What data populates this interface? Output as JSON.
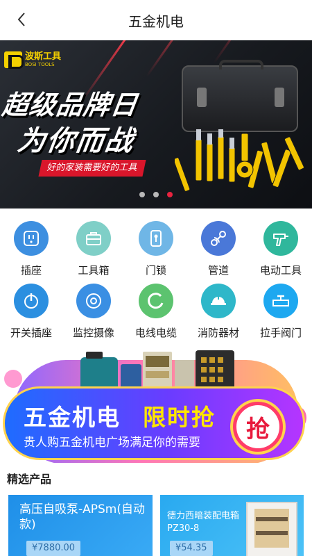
{
  "header": {
    "title": "五金机电",
    "back_icon": "chevron-left-icon"
  },
  "banner": {
    "brand_cn": "波斯工具",
    "brand_en": "BOSI TOOLS",
    "headline1": "超级品牌日",
    "headline2": "为你而战",
    "tagline": "好的家装需要好的工具",
    "slide_count": 3,
    "active_slide": 3
  },
  "categories": [
    {
      "label": "插座",
      "icon": "socket-icon",
      "color": "#3d8fe0"
    },
    {
      "label": "工具箱",
      "icon": "toolbox-icon",
      "color": "#7fcfc7"
    },
    {
      "label": "门锁",
      "icon": "door-lock-icon",
      "color": "#6fb6e6"
    },
    {
      "label": "管道",
      "icon": "pipe-icon",
      "color": "#4a78d8"
    },
    {
      "label": "电动工具",
      "icon": "drill-icon",
      "color": "#2fb79c"
    },
    {
      "label": "开关插座",
      "icon": "power-switch-icon",
      "color": "#2b8fe0"
    },
    {
      "label": "监控摄像",
      "icon": "camera-icon",
      "color": "#3a8fe3"
    },
    {
      "label": "电线电缆",
      "icon": "cable-icon",
      "color": "#5cc36f"
    },
    {
      "label": "消防器材",
      "icon": "helmet-icon",
      "color": "#2eb7c9"
    },
    {
      "label": "拉手阀门",
      "icon": "valve-icon",
      "color": "#1da8f0"
    }
  ],
  "promo": {
    "title_main": "五金机电",
    "title_accent": "限时抢",
    "subtitle": "贵人购五金机电广场满足你的需要",
    "grab_label": "抢"
  },
  "featured": {
    "section_title": "精选产品",
    "products": [
      {
        "name": "高压自吸泵-APSm(自动款)",
        "price": "¥7880.00"
      },
      {
        "name": "德力西暗装配电箱PZ30-8",
        "price": "¥54.35"
      }
    ]
  }
}
